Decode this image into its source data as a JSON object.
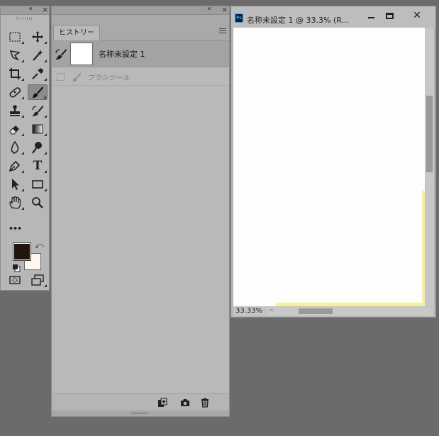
{
  "tools_panel": {
    "collapse_label": "«",
    "close_label": "×",
    "tools": [
      {
        "name": "marquee-tool-icon"
      },
      {
        "name": "move-tool-icon"
      },
      {
        "name": "lasso-tool-icon"
      },
      {
        "name": "magic-wand-tool-icon"
      },
      {
        "name": "crop-tool-icon"
      },
      {
        "name": "eyedropper-tool-icon"
      },
      {
        "name": "healing-brush-tool-icon"
      },
      {
        "name": "brush-tool-icon",
        "active": true
      },
      {
        "name": "clone-stamp-tool-icon"
      },
      {
        "name": "history-brush-tool-icon"
      },
      {
        "name": "eraser-tool-icon"
      },
      {
        "name": "gradient-tool-icon"
      },
      {
        "name": "blur-tool-icon"
      },
      {
        "name": "dodge-tool-icon"
      },
      {
        "name": "pen-tool-icon"
      },
      {
        "name": "type-tool-icon"
      },
      {
        "name": "path-selection-tool-icon"
      },
      {
        "name": "rectangle-tool-icon"
      },
      {
        "name": "hand-tool-icon"
      },
      {
        "name": "zoom-tool-icon"
      },
      {
        "name": "more-tools-icon"
      }
    ],
    "type_glyph": "T",
    "more_glyph": "•••",
    "foreground_color": "#24140e",
    "background_color": "#fdf8ec"
  },
  "history_panel": {
    "collapse_label": "«",
    "close_label": "×",
    "tab_label": "ヒストリー",
    "snapshot_label": "名称未設定 1",
    "states": [
      {
        "label": "ブラシツール"
      }
    ],
    "footer_buttons": [
      "new-document-from-state-icon",
      "snapshot-camera-icon",
      "trash-icon"
    ]
  },
  "document": {
    "title": "名称未設定 1 @ 33.3% (R...",
    "ps_badge": "Ps",
    "zoom": "33.33%",
    "min_label": "",
    "close_label": "✕",
    "canvas_color": "#fdfdfd",
    "accent_yellow": "#f4f19a"
  }
}
